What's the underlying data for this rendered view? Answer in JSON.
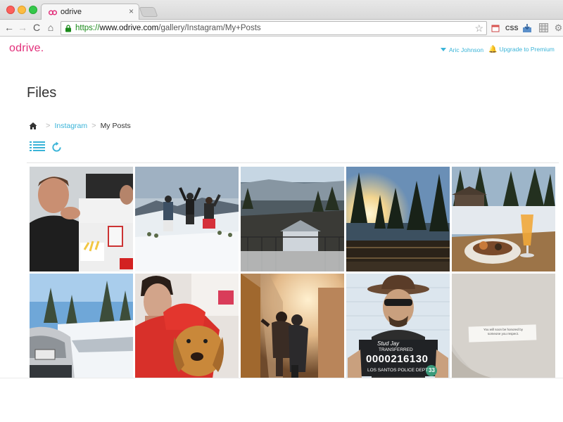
{
  "browser": {
    "tab_title": "odrive",
    "tab_close": "×",
    "url_scheme": "https://",
    "url_host": "www.odrive.com",
    "url_path": "/gallery/Instagram/My+Posts",
    "ext_css": "CSS",
    "back": "←",
    "forward": "→",
    "reload": "C",
    "home": "⌂",
    "star": "☆"
  },
  "header": {
    "logo": "odrive.",
    "user_name": "Aric Johnson",
    "upgrade": "Upgrade to Premium"
  },
  "main": {
    "title": "Files",
    "breadcrumb": {
      "link": "Instagram",
      "current": "My Posts",
      "separator": ">"
    }
  },
  "gallery": {
    "items": [
      {
        "subject": "man eating fries"
      },
      {
        "subject": "people jumping on snowy mountain"
      },
      {
        "subject": "lake view from balcony"
      },
      {
        "subject": "sunset through pine trees"
      },
      {
        "subject": "breakfast and orange juice on table"
      },
      {
        "subject": "car on snowy road"
      },
      {
        "subject": "man with dog in red hoodie"
      },
      {
        "subject": "people hugging indoors"
      },
      {
        "subject": "cowboy mugshot",
        "caption_name": "Stud Jay",
        "caption_status": "TRANSFERRED",
        "caption_number": "0000216130",
        "caption_dept": "LOS SANTOS POLICE DEPT",
        "caption_badge": "33"
      },
      {
        "subject": "fortune cookie note",
        "caption_text": "You will soon be honored by someone you respect."
      }
    ]
  },
  "colors": {
    "brand": "#e22f7a",
    "link": "#3ab4d8",
    "url_green": "#1a8a1a"
  }
}
